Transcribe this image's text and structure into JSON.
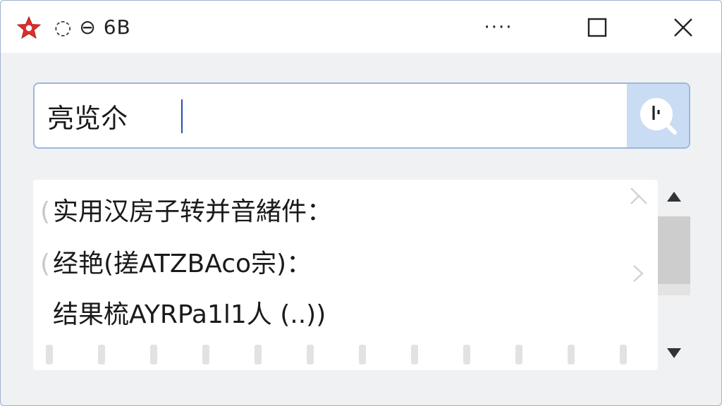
{
  "window": {
    "title": "◌ ⊖ 6B",
    "more_label": "····",
    "colors": {
      "accent": "#c9dcf3",
      "icon_red": "#d9302c",
      "border": "#9ab8de"
    },
    "icons": [
      "star-app-icon",
      "more-icon",
      "maximize-icon",
      "close-icon"
    ]
  },
  "search": {
    "value": "亮览尒",
    "button_icon": "clock-search-icon"
  },
  "results": {
    "lines": [
      "实用汉房子转并音緒件：",
      "经艳(搓ATZBAco宗)：",
      "结果梳AYRPa1l1人 (..))"
    ],
    "ghost_parens": [
      "(",
      "("
    ]
  },
  "scrollbar": {
    "up_icon": "triangle-up-icon",
    "down_icon": "triangle-down-icon"
  }
}
